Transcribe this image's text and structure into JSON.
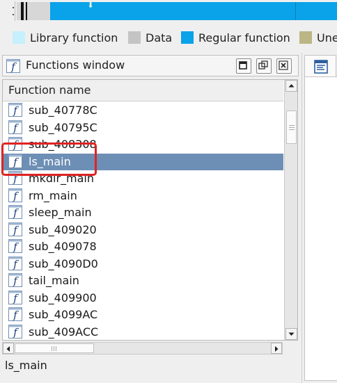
{
  "legend": {
    "items": [
      {
        "label": "Library function",
        "color": "#c6f0fb"
      },
      {
        "label": "Data",
        "color": "#c4c4c4"
      },
      {
        "label": "Regular function",
        "color": "#0aa2e8"
      },
      {
        "label": "Une",
        "color": "#bcb585"
      }
    ]
  },
  "functions_window": {
    "title": "Functions window",
    "column_header": "Function name",
    "rows": [
      {
        "name": "sub_40778C",
        "selected": false
      },
      {
        "name": "sub_40795C",
        "selected": false
      },
      {
        "name": "sub_408308",
        "selected": false
      },
      {
        "name": "ls_main",
        "selected": true
      },
      {
        "name": "mkdir_main",
        "selected": false
      },
      {
        "name": "rm_main",
        "selected": false
      },
      {
        "name": "sleep_main",
        "selected": false
      },
      {
        "name": "sub_409020",
        "selected": false
      },
      {
        "name": "sub_409078",
        "selected": false
      },
      {
        "name": "sub_4090D0",
        "selected": false
      },
      {
        "name": "tail_main",
        "selected": false
      },
      {
        "name": "sub_409900",
        "selected": false
      },
      {
        "name": "sub_4099AC",
        "selected": false
      },
      {
        "name": "sub_409ACC",
        "selected": false
      }
    ],
    "status": "ls_main"
  },
  "icons": {
    "function": "function-f-icon",
    "restore": "restore-icon",
    "float": "float-window-icon",
    "close": "close-icon",
    "pseudocode_tab": "pseudocode-tab-icon"
  },
  "colors": {
    "selection": "#6e8fb5",
    "highlight_box": "#e02222",
    "regular_function": "#0aa2e8"
  }
}
